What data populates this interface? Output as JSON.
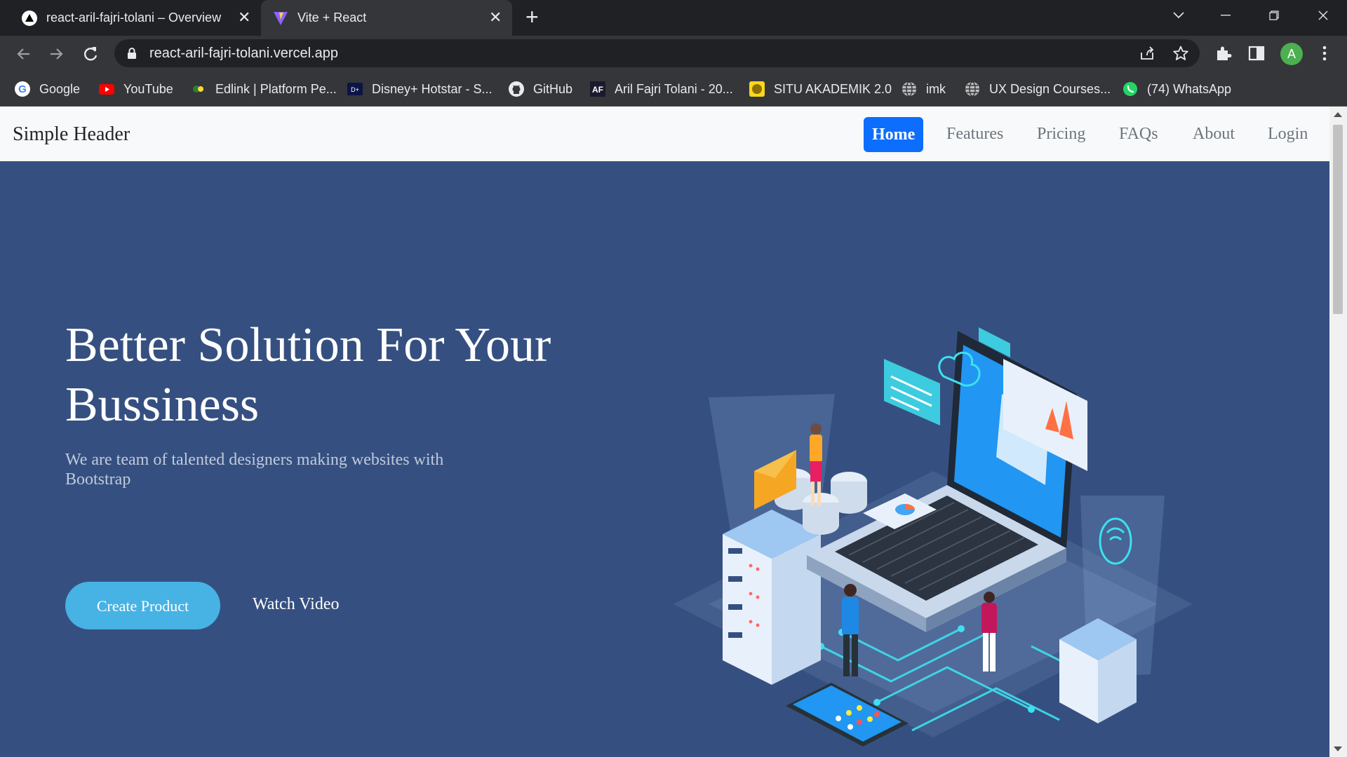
{
  "browser": {
    "tabs": [
      {
        "title": "react-aril-fajri-tolani – Overview",
        "icon": "vercel-triangle-icon",
        "active": false
      },
      {
        "title": "Vite + React",
        "icon": "vite-logo-icon",
        "active": true
      }
    ],
    "url": "react-aril-fajri-tolani.vercel.app",
    "profile_initial": "A",
    "bookmarks": [
      {
        "label": "Google",
        "icon": "google-icon"
      },
      {
        "label": "YouTube",
        "icon": "youtube-icon"
      },
      {
        "label": "Edlink | Platform Pe...",
        "icon": "edlink-icon"
      },
      {
        "label": "Disney+ Hotstar - S...",
        "icon": "hotstar-icon"
      },
      {
        "label": "GitHub",
        "icon": "github-icon"
      },
      {
        "label": "Aril Fajri Tolani - 20...",
        "icon": "aft-icon"
      },
      {
        "label": "SITU AKADEMIK 2.0",
        "icon": "situ-icon"
      },
      {
        "label": "imk",
        "icon": "globe-icon"
      },
      {
        "label": "UX Design Courses...",
        "icon": "globe-icon"
      },
      {
        "label": "(74) WhatsApp",
        "icon": "whatsapp-icon"
      }
    ]
  },
  "site": {
    "brand": "Simple Header",
    "nav": [
      "Home",
      "Features",
      "Pricing",
      "FAQs",
      "About",
      "Login"
    ],
    "active_nav": "Home",
    "hero": {
      "title": "Better Solution For Your Bussiness",
      "subtitle": "We are team of talented designers making websites with Bootstrap",
      "primary_button": "Create Product",
      "secondary_button": "Watch Video"
    }
  },
  "colors": {
    "hero_bg": "#355080",
    "primary_button": "#47b2e4",
    "nav_active": "#0d6efd",
    "header_bg": "#f8f9fa",
    "browser_dark": "#202124",
    "browser_toolbar": "#35363a"
  }
}
